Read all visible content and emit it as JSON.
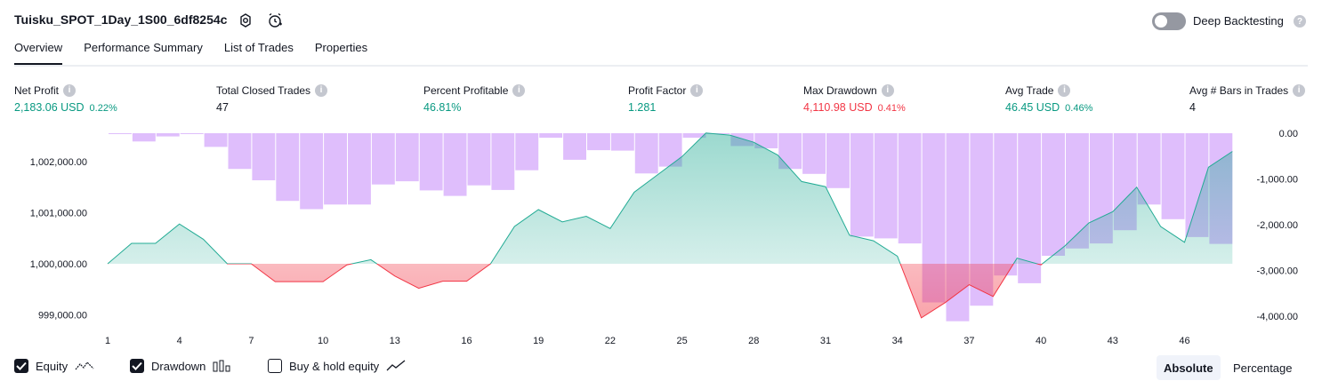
{
  "header": {
    "title": "Tuisku_SPOT_1Day_1S00_6df8254c",
    "deep_backtesting_label": "Deep Backtesting"
  },
  "tabs": [
    {
      "label": "Overview",
      "active": true
    },
    {
      "label": "Performance Summary"
    },
    {
      "label": "List of Trades"
    },
    {
      "label": "Properties"
    }
  ],
  "metrics": [
    {
      "label": "Net Profit",
      "value": "2,183.06 USD",
      "pct": "0.22%",
      "color": "#089981"
    },
    {
      "label": "Total Closed Trades",
      "value": "47",
      "pct": "",
      "color": "#131722"
    },
    {
      "label": "Percent Profitable",
      "value": "46.81%",
      "pct": "",
      "color": "#089981"
    },
    {
      "label": "Profit Factor",
      "value": "1.281",
      "pct": "",
      "color": "#089981"
    },
    {
      "label": "Max Drawdown",
      "value": "4,110.98 USD",
      "pct": "0.41%",
      "color": "#f23645"
    },
    {
      "label": "Avg Trade",
      "value": "46.45 USD",
      "pct": "0.46%",
      "color": "#089981"
    },
    {
      "label": "Avg # Bars in Trades",
      "value": "4",
      "pct": "",
      "color": "#131722"
    }
  ],
  "legend": {
    "equity_label": "Equity",
    "drawdown_label": "Drawdown",
    "buy_hold_label": "Buy & hold equity",
    "equity_checked": true,
    "drawdown_checked": true,
    "buy_hold_checked": false
  },
  "modes": {
    "absolute_label": "Absolute",
    "percentage_label": "Percentage",
    "active": "Absolute"
  },
  "chart_data": {
    "type": "area",
    "x_tick_labels": [
      "1",
      "4",
      "7",
      "10",
      "13",
      "16",
      "19",
      "22",
      "25",
      "28",
      "31",
      "34",
      "37",
      "40",
      "43",
      "46"
    ],
    "y_left_tick_labels": [
      "1,002,000.00",
      "1,001,000.00",
      "1,000,000.00",
      "999,000.00"
    ],
    "y_right_tick_labels": [
      "0.00",
      "-1,000.00",
      "-2,000.00",
      "-3,000.00",
      "-4,000.00"
    ],
    "baseline": 1000000,
    "equity": {
      "x": [
        1,
        2,
        3,
        4,
        5,
        6,
        7,
        8,
        9,
        10,
        11,
        12,
        13,
        14,
        15,
        16,
        17,
        18,
        19,
        20,
        21,
        22,
        23,
        24,
        25,
        26,
        27,
        28,
        29,
        30,
        31,
        32,
        33,
        34,
        35,
        36,
        37,
        38,
        39,
        40,
        41,
        42,
        43,
        44,
        45,
        46,
        47,
        48
      ],
      "y": [
        1000000,
        1000400,
        1000400,
        1000780,
        1000480,
        1000000,
        1000000,
        999650,
        999650,
        999650,
        999980,
        1000080,
        999760,
        999520,
        999660,
        999660,
        1000000,
        1000730,
        1001060,
        1000820,
        1000930,
        1000690,
        1001400,
        1001750,
        1002100,
        1002560,
        1002520,
        1002380,
        1002130,
        1001610,
        1001510,
        1000560,
        1000450,
        1000150,
        998940,
        999240,
        999590,
        999360,
        1000110,
        999980,
        1000350,
        1000800,
        1001020,
        1001500,
        1000730,
        1000420,
        1001890,
        1002200
      ]
    },
    "drawdown": {
      "x": [
        1,
        2,
        3,
        4,
        5,
        6,
        7,
        8,
        9,
        10,
        11,
        12,
        13,
        14,
        15,
        16,
        17,
        18,
        19,
        20,
        21,
        22,
        23,
        24,
        25,
        26,
        27,
        28,
        29,
        30,
        31,
        32,
        33,
        34,
        35,
        36,
        37,
        38,
        39,
        40,
        41,
        42,
        43,
        44,
        45,
        46,
        47
      ],
      "y": [
        0,
        -180,
        -70,
        0,
        -300,
        -780,
        -1030,
        -1480,
        -1660,
        -1560,
        -1560,
        -1120,
        -1050,
        -1250,
        -1370,
        -1140,
        -1240,
        -810,
        -100,
        -580,
        -370,
        -380,
        -880,
        -730,
        -100,
        0,
        -280,
        -330,
        -780,
        -890,
        -1200,
        -2260,
        -2300,
        -2410,
        -3700,
        -4110,
        -3770,
        -3110,
        -3280,
        -2680,
        -2520,
        -2410,
        -2120,
        -1560,
        -1880,
        -2270,
        -2420
      ]
    }
  }
}
